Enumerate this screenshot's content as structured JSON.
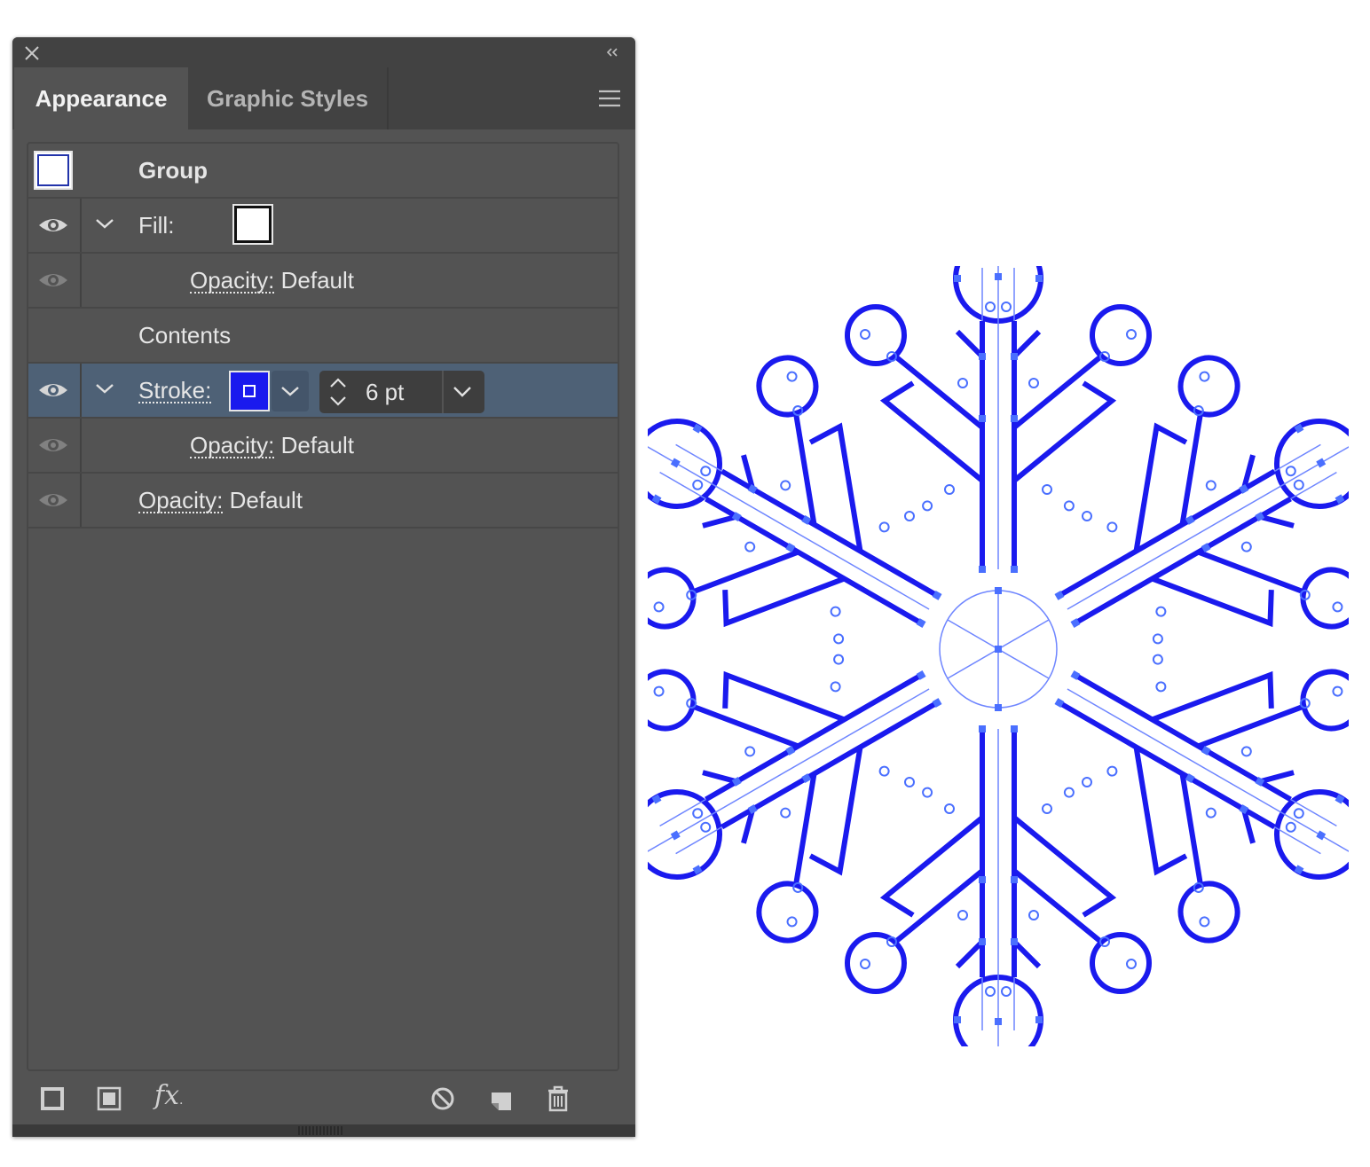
{
  "panel": {
    "tabs": [
      {
        "label": "Appearance",
        "active": true
      },
      {
        "label": "Graphic Styles",
        "active": false
      }
    ],
    "rows": {
      "group_label": "Group",
      "fill_label": "Fill:",
      "fill_color": "#ffffff",
      "fill_opacity_label": "Opacity:",
      "fill_opacity_value": "Default",
      "contents_label": "Contents",
      "stroke_label": "Stroke:",
      "stroke_color": "#1a1aee",
      "stroke_weight": "6 pt",
      "stroke_opacity_label": "Opacity:",
      "stroke_opacity_value": "Default",
      "group_opacity_label": "Opacity:",
      "group_opacity_value": "Default"
    },
    "bottom_icons": [
      "add-new-stroke-icon",
      "add-new-fill-icon",
      "add-new-effect-icon",
      "clear-appearance-icon",
      "duplicate-item-icon",
      "delete-item-icon"
    ],
    "fx_label": "fx"
  },
  "artwork": {
    "name": "snowflake",
    "stroke_color": "#1a1aee",
    "anchor_color": "#4a6fff"
  }
}
